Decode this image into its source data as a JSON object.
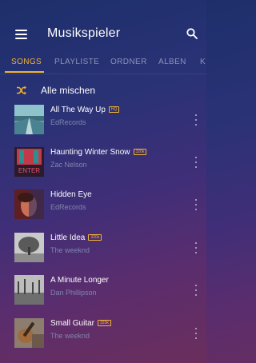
{
  "app": {
    "title": "Musikspieler"
  },
  "tabs": [
    {
      "label": "SONGS",
      "active": true
    },
    {
      "label": "PLAYLISTE",
      "active": false
    },
    {
      "label": "ORDNER",
      "active": false
    },
    {
      "label": "ALBEN",
      "active": false
    },
    {
      "label": "K",
      "active": false
    }
  ],
  "shuffle": {
    "label": "Alle mischen"
  },
  "songs": [
    {
      "title": "All The Way Up",
      "badge": "HQ",
      "artist": "EdRecords",
      "art": "road-sunset-art"
    },
    {
      "title": "Haunting Winter Snow",
      "badge": "320k",
      "artist": "Zac Nelson",
      "art": "enter-neon-art"
    },
    {
      "title": "Hidden Eye",
      "badge": "",
      "artist": "EdRecords",
      "art": "portrait-art"
    },
    {
      "title": "Little Idea",
      "badge": "320k",
      "artist": "The weeknd",
      "art": "tree-art"
    },
    {
      "title": "A Minute Longer",
      "badge": "",
      "artist": "Dan Phillipson",
      "art": "forest-art"
    },
    {
      "title": "Small Guitar",
      "badge": "320k",
      "artist": "The weeknd",
      "art": "guitar-art"
    }
  ],
  "colors": {
    "accent": "#f2b233",
    "secondary_text": "#7e86ad"
  }
}
